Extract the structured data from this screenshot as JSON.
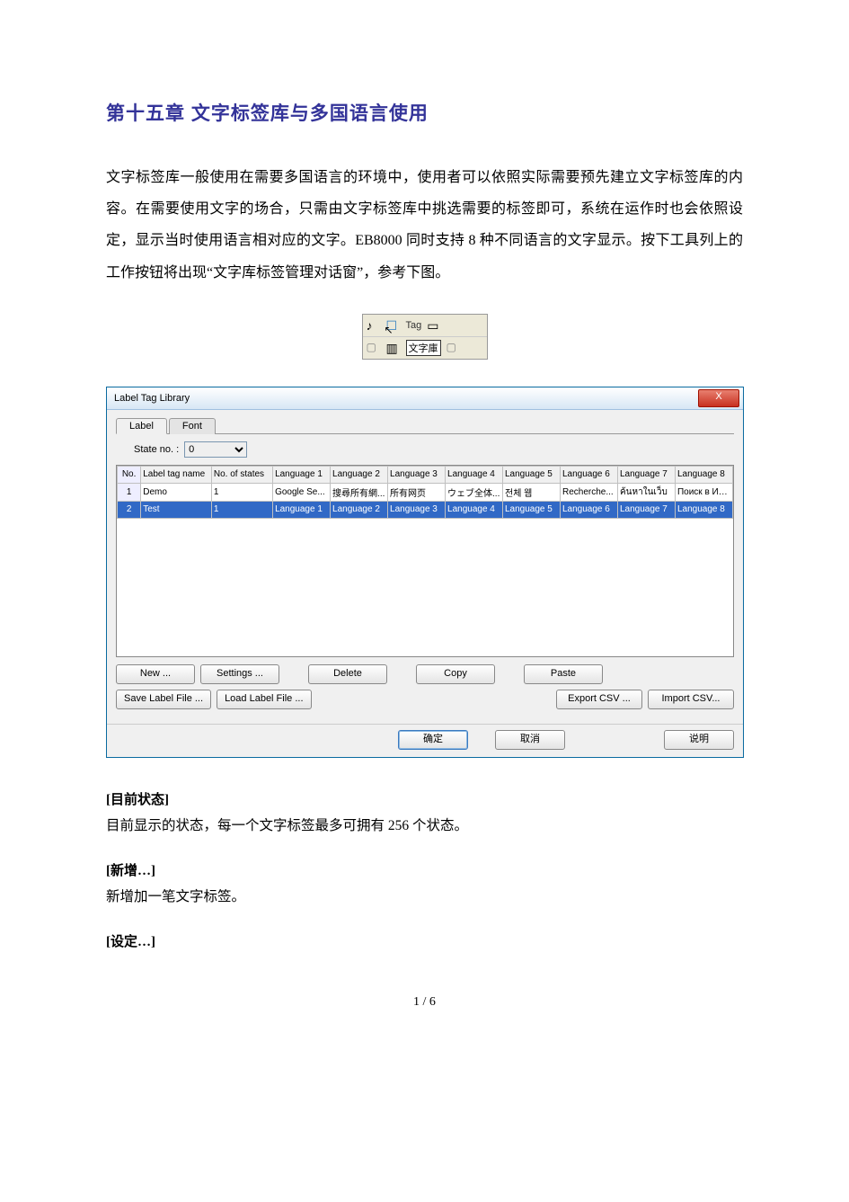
{
  "chapter_title": "第十五章 文字标签库与多国语言使用",
  "intro_paragraph": "文字标签库一般使用在需要多国语言的环境中，使用者可以依照实际需要预先建立文字标签库的内容。在需要使用文字的场合，只需由文字标签库中挑选需要的标签即可，系统在运作时也会依照设定，显示当时使用语言相对应的文字。EB8000 同时支持 8 种不同语言的文字显示。按下工具列上的工作按钮将出现“文字库标签管理对话窗”，参考下图。",
  "toolbar": {
    "tag_label": "Tag",
    "tooltip": "文字庫"
  },
  "dialog": {
    "title": "Label Tag Library",
    "close": "X",
    "tabs": {
      "label_tab": "Label",
      "font_tab": "Font"
    },
    "state_no_label": "State no. :",
    "state_no_value": "0",
    "columns": {
      "no": "No.",
      "name": "Label tag name",
      "states": "No. of states",
      "lang1": "Language 1",
      "lang2": "Language 2",
      "lang3": "Language 3",
      "lang4": "Language 4",
      "lang5": "Language 5",
      "lang6": "Language 6",
      "lang7": "Language 7",
      "lang8": "Language 8"
    },
    "rows": [
      {
        "no": "1",
        "name": "Demo",
        "states": "1",
        "l1": "Google Se...",
        "l2": "搜尋所有網...",
        "l3": "所有网页",
        "l4": "ウェブ全体...",
        "l5": "전체 웹",
        "l6": "Recherche...",
        "l7": "ค้นหาในเว็บ",
        "l8": "Поиск в Ин..."
      },
      {
        "no": "2",
        "name": "Test",
        "states": "1",
        "l1": "Language 1",
        "l2": "Language 2",
        "l3": "Language 3",
        "l4": "Language 4",
        "l5": "Language 5",
        "l6": "Language 6",
        "l7": "Language 7",
        "l8": "Language 8"
      }
    ],
    "buttons": {
      "new": "New ...",
      "settings": "Settings ...",
      "delete": "Delete",
      "copy": "Copy",
      "paste": "Paste",
      "save_label": "Save Label File ...",
      "load_label": "Load Label File ...",
      "export_csv": "Export CSV ...",
      "import_csv": "Import CSV...",
      "ok": "确定",
      "cancel": "取消",
      "help": "说明"
    }
  },
  "sections": {
    "current_state_h": "[目前状态]",
    "current_state_p": "目前显示的状态，每一个文字标签最多可拥有 256 个状态。",
    "new_h": "[新增…]",
    "new_p": "新增加一笔文字标签。",
    "settings_h": "[设定…]"
  },
  "page_number": "1 / 6"
}
